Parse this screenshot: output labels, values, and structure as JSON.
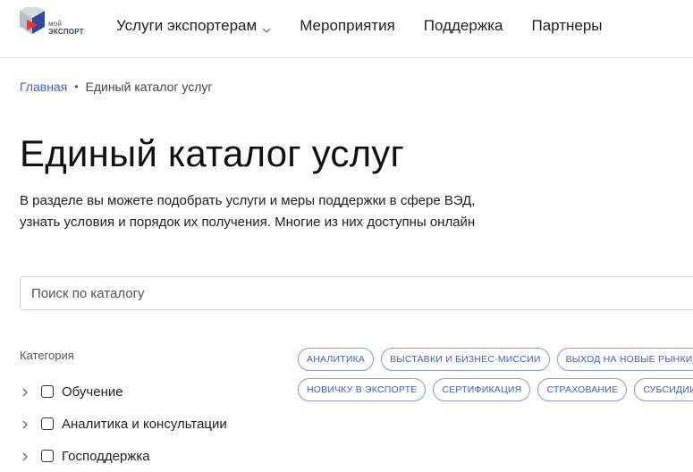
{
  "colors": {
    "accent": "#3d5fd6",
    "tag_border": "#8a9ad6",
    "logo_blue": "#2f4aa6",
    "logo_red": "#e53935"
  },
  "logo": {
    "line1": "мой",
    "line2": "экспорт"
  },
  "nav": {
    "items": [
      "Услуги экспортерам",
      "Мероприятия",
      "Поддержка",
      "Партнеры"
    ]
  },
  "breadcrumb": {
    "home": "Главная",
    "separator": "•",
    "current": "Единый каталог услуг"
  },
  "page": {
    "title": "Единый каталог услуг",
    "desc_line1": "В разделе вы можете подобрать услуги и меры поддержки в сфере ВЭД,",
    "desc_line2": "узнать условия и порядок их получения. Многие из них доступны онлайн"
  },
  "search": {
    "placeholder": "Поиск по каталогу",
    "value": ""
  },
  "categories": {
    "heading": "Категория",
    "items": [
      "Обучение",
      "Аналитика и консультации",
      "Господдержка"
    ]
  },
  "tags": {
    "row1": [
      "АНАЛИТИКА",
      "ВЫСТАВКИ И БИЗНЕС-МИССИИ",
      "ВЫХОД НА НОВЫЕ РЫНКИ"
    ],
    "row2": [
      "НОВИЧКУ В ЭКСПОРТЕ",
      "СЕРТИФИКАЦИЯ",
      "СТРАХОВАНИЕ",
      "СУБСИДИИ"
    ]
  }
}
